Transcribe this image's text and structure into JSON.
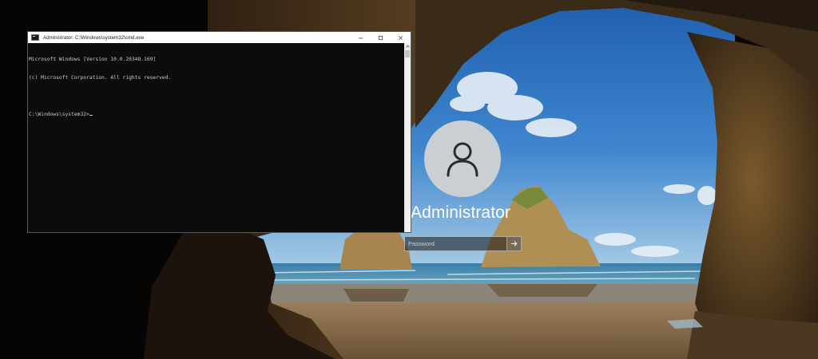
{
  "login": {
    "username": "Administrator",
    "password_placeholder": "Password",
    "avatar_icon": "user-icon",
    "submit_icon": "arrow-right-icon"
  },
  "cmd_window": {
    "title": "Administrator: C:\\Windows\\system32\\cmd.exe",
    "app_icon": "cmd-icon",
    "controls": [
      "minimize-icon",
      "maximize-icon",
      "close-icon"
    ],
    "lines": [
      "Microsoft Windows [Version 10.0.20348.169]",
      "(c) Microsoft Corporation. All rights reserved.",
      "",
      "C:\\Windows\\system32>"
    ]
  },
  "colors": {
    "console_background": "#0c0c0c",
    "console_text": "#cccccc",
    "titlebar": "#ffffff",
    "avatar_background": "#c9cfd3"
  }
}
